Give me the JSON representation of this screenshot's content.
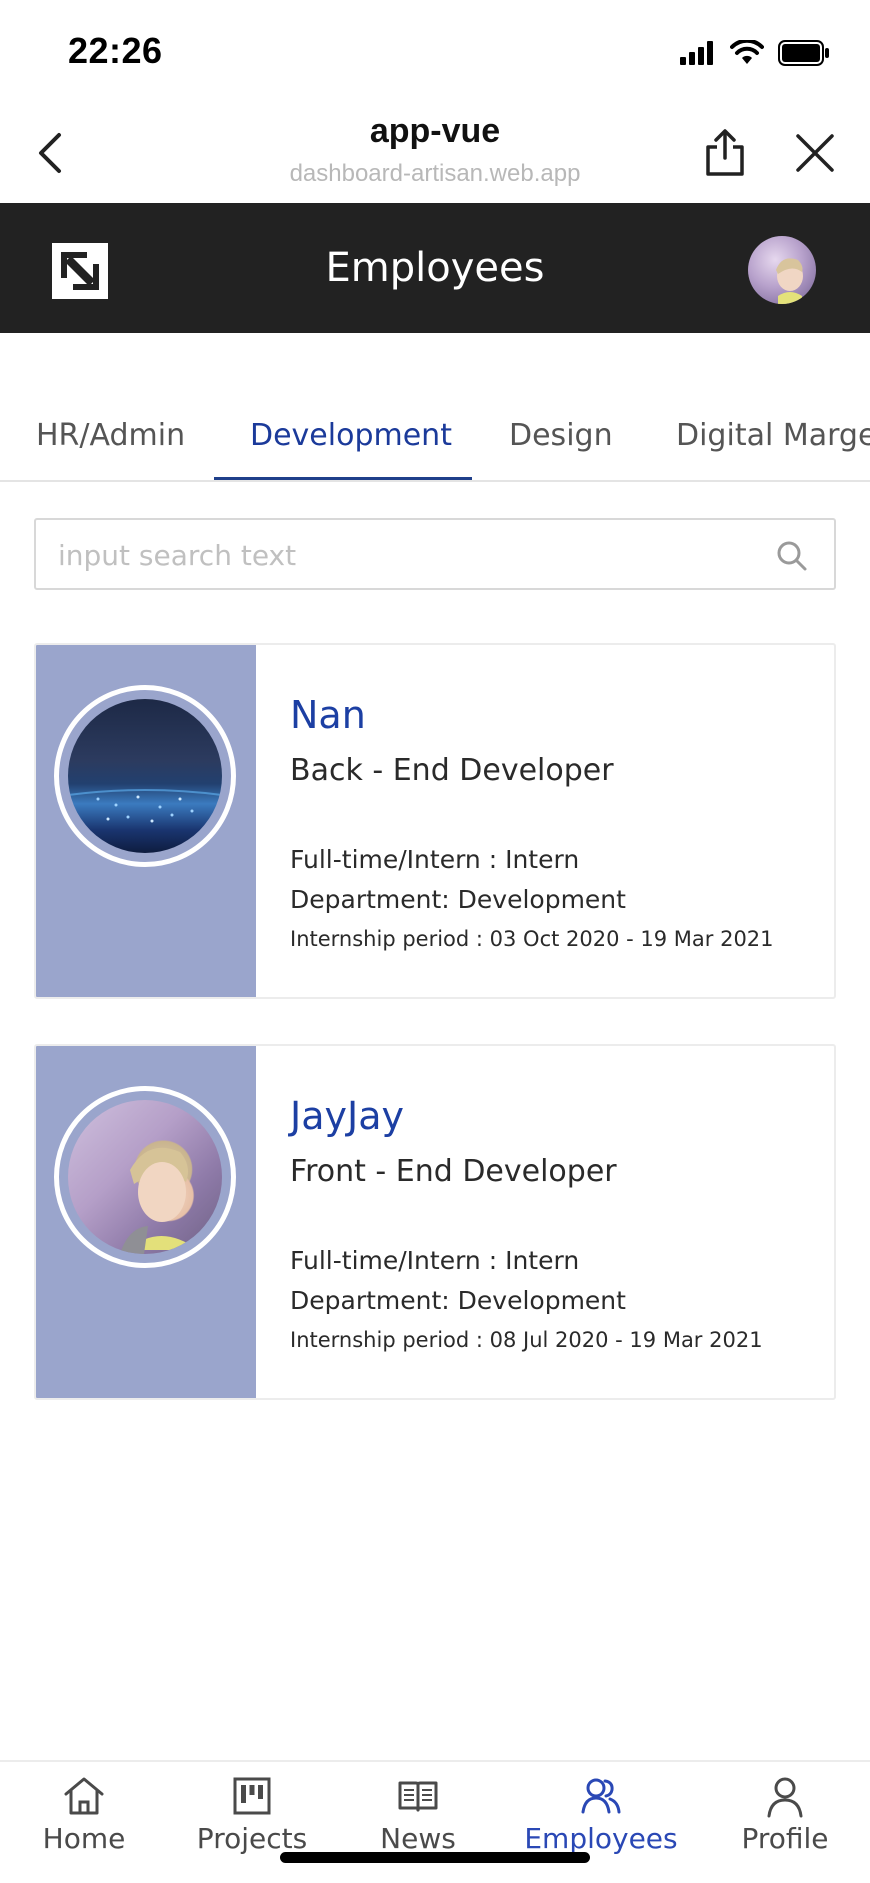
{
  "status_bar": {
    "time": "22:26"
  },
  "browser": {
    "title": "app-vue",
    "url": "dashboard-artisan.web.app"
  },
  "header": {
    "title": "Employees"
  },
  "tabs": [
    {
      "label": "HR/Admin",
      "active": false
    },
    {
      "label": "Development",
      "active": true
    },
    {
      "label": "Design",
      "active": false
    },
    {
      "label": "Digital Marget",
      "active": false
    }
  ],
  "search": {
    "placeholder": "input search text",
    "value": ""
  },
  "employees": [
    {
      "name": "Nan",
      "role": "Back - End Developer",
      "employment": "Full-time/Intern : Intern",
      "department": "Department: Development",
      "internship": "Internship period : 03 Oct 2020 - 19 Mar 2021",
      "photo": "night-city-photo"
    },
    {
      "name": "JayJay",
      "role": "Front - End Developer",
      "employment": "Full-time/Intern : Intern",
      "department": "Department: Development",
      "internship": "Internship period : 08 Jul 2020 - 19 Mar 2021",
      "photo": "person-photo"
    }
  ],
  "bottom_nav": [
    {
      "label": "Home",
      "icon": "home-icon",
      "active": false
    },
    {
      "label": "Projects",
      "icon": "projects-icon",
      "active": false
    },
    {
      "label": "News",
      "icon": "news-icon",
      "active": false
    },
    {
      "label": "Employees",
      "icon": "employees-icon",
      "active": true
    },
    {
      "label": "Profile",
      "icon": "profile-icon",
      "active": false
    }
  ],
  "colors": {
    "accent": "#1c3fa3",
    "header_bg": "#222222",
    "card_side": "#9aa5cc"
  }
}
